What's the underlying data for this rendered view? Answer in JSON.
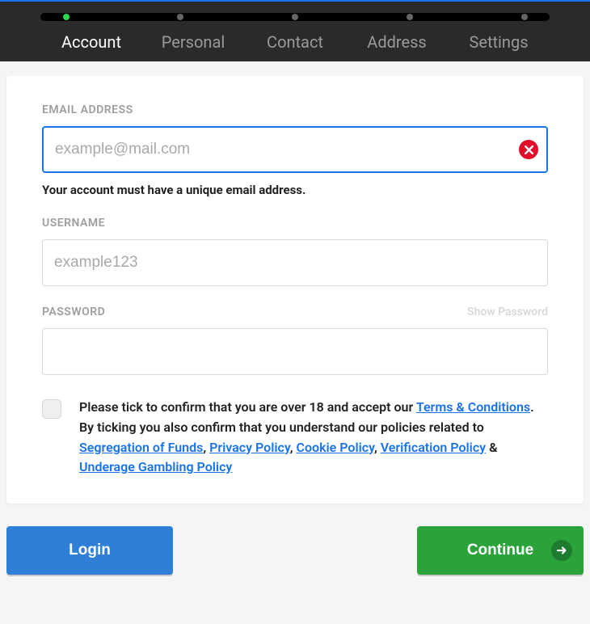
{
  "steps": {
    "items": [
      {
        "label": "Account",
        "active": true
      },
      {
        "label": "Personal",
        "active": false
      },
      {
        "label": "Contact",
        "active": false
      },
      {
        "label": "Address",
        "active": false
      },
      {
        "label": "Settings",
        "active": false
      }
    ]
  },
  "fields": {
    "email": {
      "label": "EMAIL ADDRESS",
      "placeholder": "example@mail.com",
      "value": "",
      "error": "Your account must have a unique email address."
    },
    "username": {
      "label": "USERNAME",
      "placeholder": "example123",
      "value": ""
    },
    "password": {
      "label": "PASSWORD",
      "show_label": "Show Password",
      "value": ""
    }
  },
  "consent": {
    "pre1": "Please tick to confirm that you are over 18 and accept our ",
    "terms": "Terms & Conditions",
    "post1": ". By ticking you also confirm that you understand our policies related to ",
    "seg": "Segregation of Funds",
    "comma1": ", ",
    "privacy": "Privacy Policy",
    "comma2": ", ",
    "cookie": "Cookie Policy",
    "comma3": ", ",
    "verify": "Verification Policy",
    "amp": " & ",
    "underage": "Underage Gambling Policy"
  },
  "buttons": {
    "login": "Login",
    "continue": "Continue"
  }
}
